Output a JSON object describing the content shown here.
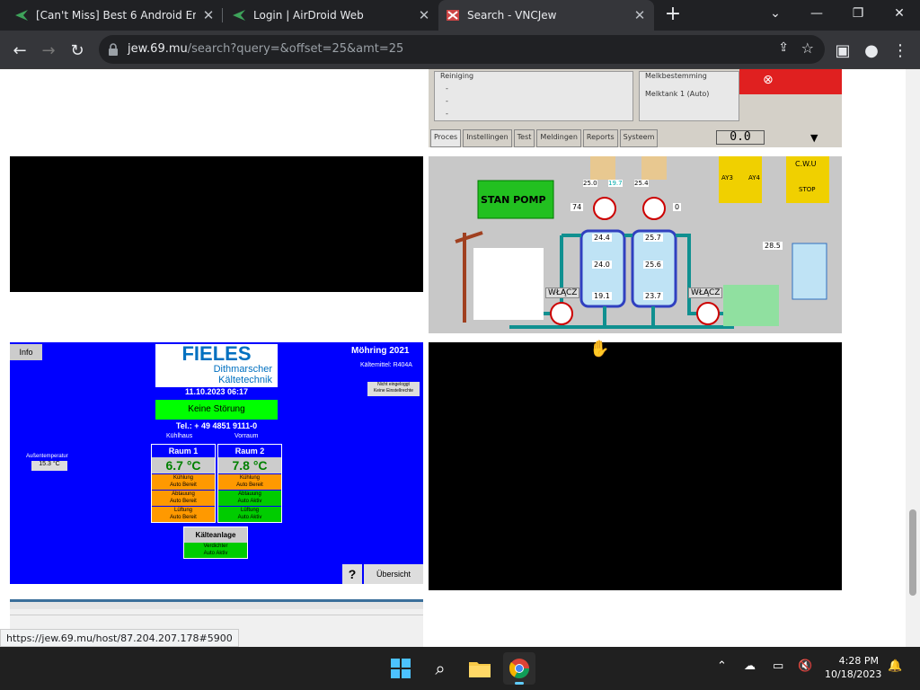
{
  "tabs": [
    {
      "title": "[Can't Miss] Best 6 Android Emul",
      "icon": "airdroid-icon"
    },
    {
      "title": "Login | AirDroid Web",
      "icon": "airdroid-icon"
    },
    {
      "title": "Search - VNCJew",
      "icon": "vncjew-icon",
      "active": true
    }
  ],
  "address": {
    "host": "jew.69.mu",
    "path": "/search?query=&offset=25&amt=25"
  },
  "status_url": "https://jew.69.mu/host/87.204.207.178#5900",
  "thumb1": {
    "box_left": "Reiniging",
    "box_left_lines": [
      "-",
      "-",
      "-"
    ],
    "box_right": "Melkbestemming",
    "box_right_text": "Melktank 1 (Auto)",
    "tabs": [
      "Proces",
      "Instellingen",
      "Test",
      "Meldingen",
      "Reports",
      "Systeem"
    ],
    "display": "0.0"
  },
  "thumb2": {
    "stan": "STAN POMP",
    "pct1": "74",
    "pct2": "0",
    "t1": "25.0",
    "t2": "19.7",
    "t3": "25.4",
    "tank1": [
      "24.4",
      "24.0",
      "19.1"
    ],
    "tank2": [
      "25.7",
      "25.6",
      "23.7"
    ],
    "wlacz": "WŁĄCZ",
    "cwu": "C.W.U",
    "ay3": "AY3",
    "ay4": "AY4",
    "stop": "STOP",
    "temp": "28.5"
  },
  "thumb3": {
    "info": "Info",
    "brand": "FIELES",
    "sub": "Dithmarscher",
    "sub2": "Kältetechnik",
    "date": "11.10.2023 06:17",
    "status": "Keine Störung",
    "tel": "Tel.: + 49 4851 9111-0",
    "title": "Möhring 2021",
    "refrigerant": "Kältemittel: R404A",
    "badge1": "Nicht eingeloggt",
    "badge2": "Keine Einstellrechte",
    "kuehlhaus": "Kühlhaus",
    "vorraum": "Vorraum",
    "outside_label": "Außentemperatur",
    "outside_value": "15.3 °C",
    "raum1": "Raum 1",
    "raum2": "Raum 2",
    "r1temp": "6.7 °C",
    "r2temp": "7.8 °C",
    "r1": [
      "Kühlung",
      "Auto Bereit",
      "Abtauung",
      "Auto Bereit",
      "Lüftung",
      "Auto Bereit"
    ],
    "r2": [
      "Kühlung",
      "Auto Bereit",
      "Abtauung",
      "Auto Aktiv",
      "Lüftung",
      "Auto Aktiv"
    ],
    "kaelte": "Kälteanlage",
    "verdichter": "Verdichter",
    "verdichter2": "Auto Aktiv",
    "help": "?",
    "uebersicht": "Übersicht"
  },
  "taskbar": {
    "time": "4:28 PM",
    "date": "10/18/2023"
  },
  "colors": {
    "chrome_dark": "#202124",
    "chrome_toolbar": "#35363a",
    "hmi_blue": "#0000ff",
    "hmi_green": "#00c000",
    "hmi_orange": "#ff9900"
  }
}
